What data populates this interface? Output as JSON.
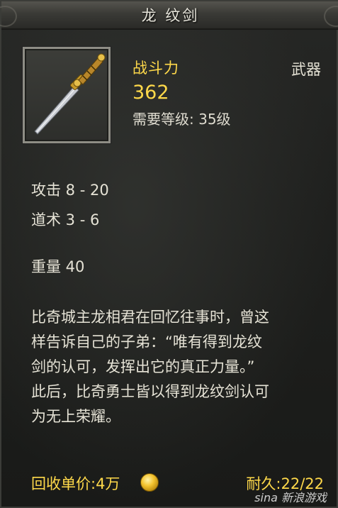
{
  "window": {
    "title": "龙 纹剑"
  },
  "item": {
    "icon": "sword-icon",
    "power_label": "战斗力",
    "power_value": "362",
    "required_level": "需要等级: 35级",
    "type": "武器"
  },
  "stats": {
    "attack": "攻击 8 - 20",
    "taoism": "道术 3 - 6",
    "weight": "重量 40"
  },
  "description": [
    "比奇城主龙相君在回忆往事时，曾这",
    "样告诉自己的子弟：“唯有得到龙纹",
    "剑的认可，发挥出它的真正力量。”",
    "此后，比奇勇士皆以得到龙纹剑认可",
    "为无上荣耀。"
  ],
  "footer": {
    "sell_price": "回收单价:4万",
    "coin_icon": "gold-coin-icon",
    "durability": "耐久:22/22"
  },
  "watermark": "sina 新浪游戏",
  "colors": {
    "gold_text": "#ffd94a",
    "normal_text": "#e6e3d6",
    "background": "#1f201e"
  }
}
